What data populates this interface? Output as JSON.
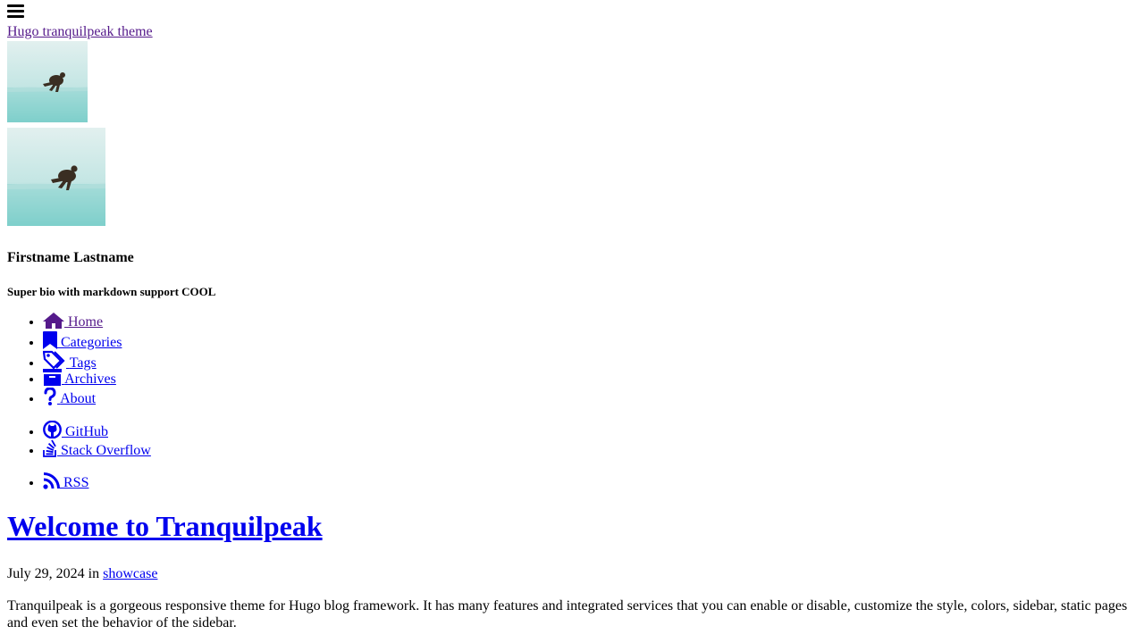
{
  "header": {
    "menu_icon": "hamburger-menu-icon",
    "site_title": "Hugo tranquilpeak theme"
  },
  "author": {
    "name": "Firstname Lastname",
    "bio": "Super bio with markdown support COOL"
  },
  "nav": {
    "main": [
      {
        "label": "Home",
        "icon": "home-icon"
      },
      {
        "label": "Categories",
        "icon": "bookmark-icon"
      },
      {
        "label": "Tags",
        "icon": "tags-icon"
      },
      {
        "label": "Archives",
        "icon": "archive-icon"
      },
      {
        "label": "About",
        "icon": "question-icon"
      }
    ],
    "social": [
      {
        "label": "GitHub",
        "icon": "github-icon"
      },
      {
        "label": "Stack Overflow",
        "icon": "stack-overflow-icon"
      }
    ],
    "feed": [
      {
        "label": "RSS",
        "icon": "rss-icon"
      }
    ]
  },
  "post": {
    "title": "Welcome to Tranquilpeak",
    "date": "July 29, 2024",
    "in_word": "in",
    "category": "showcase",
    "excerpt": "Tranquilpeak is a gorgeous responsive theme for Hugo blog framework. It has many features and integrated services that you can enable or disable, customize the style, colors, sidebar, static pages and even set the behavior of the sidebar."
  },
  "colors": {
    "link": "#0000ee",
    "visited_link": "#551a8b",
    "text": "#000000",
    "background": "#ffffff"
  }
}
